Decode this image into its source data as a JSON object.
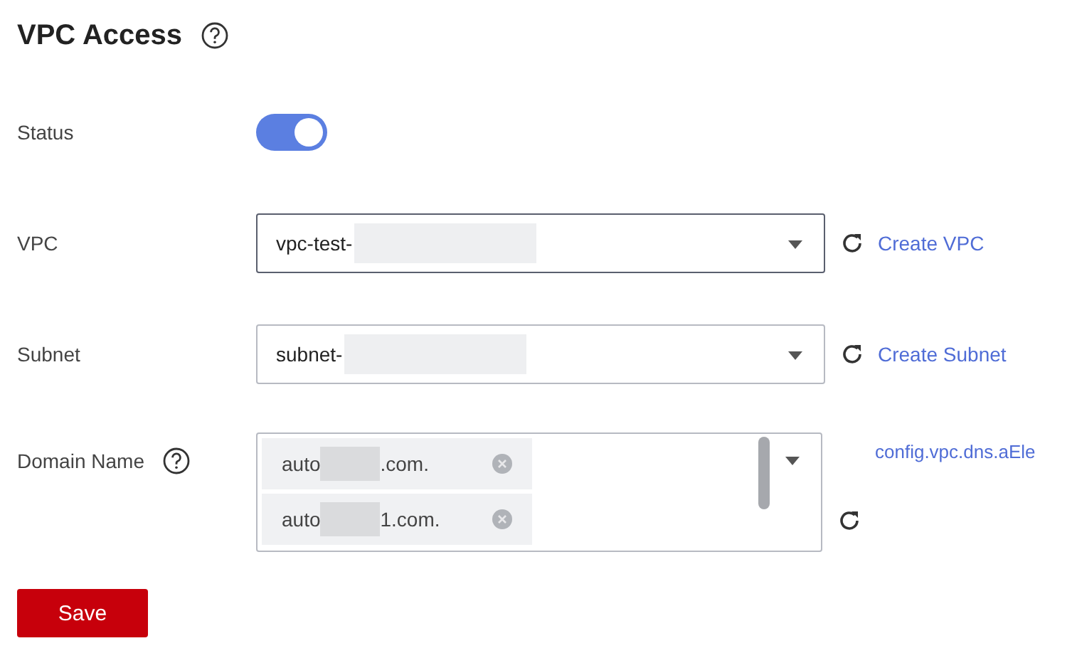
{
  "title": "VPC Access",
  "status": {
    "label": "Status",
    "on": true
  },
  "vpc": {
    "label": "VPC",
    "value": "vpc-test-",
    "link": "Create VPC"
  },
  "subnet": {
    "label": "Subnet",
    "value": "subnet-",
    "link": "Create Subnet"
  },
  "domain": {
    "label": "Domain Name",
    "tags": [
      {
        "prefix": "auto",
        "suffix": ".com."
      },
      {
        "prefix": "auto",
        "suffix": "1.com."
      }
    ],
    "link": "config.vpc.dns.aEle"
  },
  "save": "Save"
}
